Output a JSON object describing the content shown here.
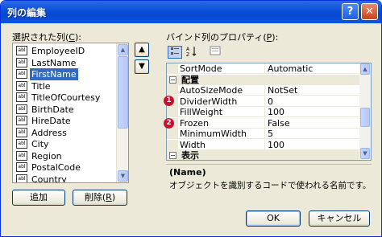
{
  "window": {
    "title": "列の編集",
    "help_label": "?",
    "close_label": "✕"
  },
  "left_panel": {
    "label": "選択された列(",
    "label_key": "C",
    "label_end": "):",
    "columns": [
      {
        "icon": "abl",
        "name": "EmployeeID"
      },
      {
        "icon": "abl",
        "name": "LastName"
      },
      {
        "icon": "abl",
        "name": "FirstName",
        "selected": true
      },
      {
        "icon": "abl",
        "name": "Title"
      },
      {
        "icon": "abl",
        "name": "TitleOfCourtesy"
      },
      {
        "icon": "abl",
        "name": "BirthDate"
      },
      {
        "icon": "abl",
        "name": "HireDate"
      },
      {
        "icon": "abl",
        "name": "Address"
      },
      {
        "icon": "abl",
        "name": "City"
      },
      {
        "icon": "abl",
        "name": "Region"
      },
      {
        "icon": "abl",
        "name": "PostalCode"
      },
      {
        "icon": "abl",
        "name": "Country"
      }
    ],
    "add_button": "追加",
    "delete_button_prefix": "削除(",
    "delete_button_key": "R",
    "delete_button_suffix": ")"
  },
  "move_buttons": {
    "up": "▲",
    "down": "▼"
  },
  "right_panel": {
    "label": "バインド列のプロパティ(",
    "label_key": "P",
    "label_end": "):",
    "toolbar": {
      "categorized_icon": "categorized-icon",
      "alphabetical_icon": "alphabetical-icon",
      "property_pages_icon": "property-pages-icon"
    },
    "properties": [
      {
        "type": "prop",
        "name": "SortMode",
        "value": "Automatic"
      },
      {
        "type": "cat",
        "name": "配置",
        "toggle": "−"
      },
      {
        "type": "prop",
        "name": "AutoSizeMode",
        "value": "NotSet"
      },
      {
        "type": "prop",
        "name": "DividerWidth",
        "value": "0"
      },
      {
        "type": "prop",
        "name": "FillWeight",
        "value": "100"
      },
      {
        "type": "prop",
        "name": "Frozen",
        "value": "False"
      },
      {
        "type": "prop",
        "name": "MinimumWidth",
        "value": "5"
      },
      {
        "type": "prop",
        "name": "Width",
        "value": "100"
      },
      {
        "type": "cat",
        "name": "表示",
        "toggle": "−"
      }
    ],
    "markers": [
      "1",
      "2"
    ],
    "description": {
      "title": "(Name)",
      "text": "オブジェクトを識別するコードで使われる名前です。"
    }
  },
  "footer": {
    "ok": "OK",
    "cancel": "キャンセル"
  }
}
